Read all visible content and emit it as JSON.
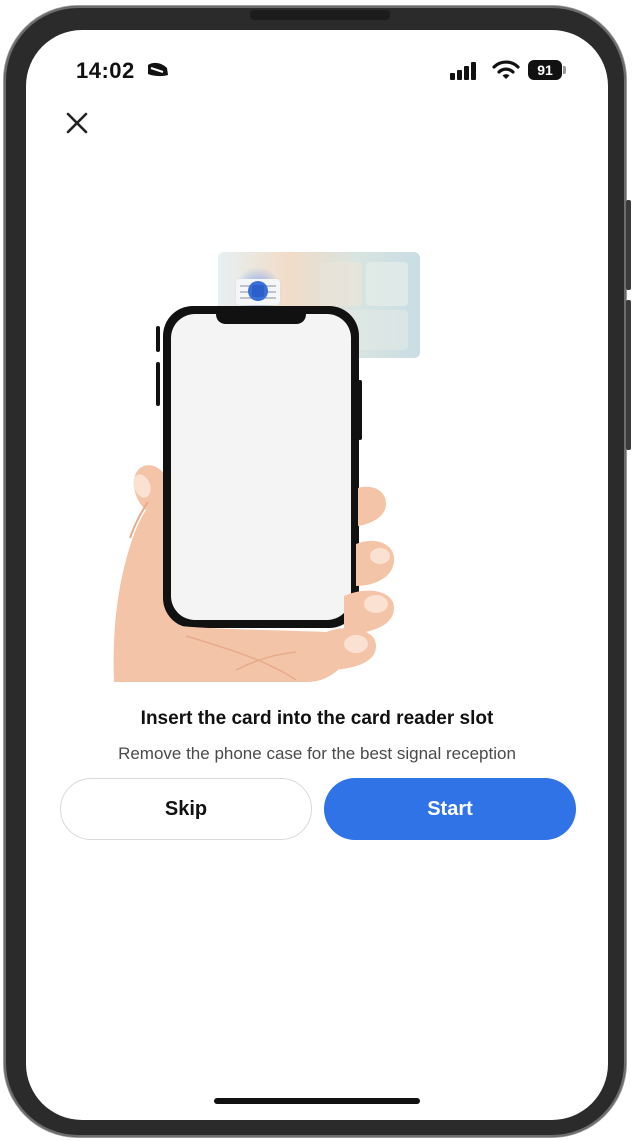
{
  "status_bar": {
    "time": "14:02",
    "battery_level": "91",
    "icons": [
      "focus-mode-icon",
      "cellular-signal-icon",
      "wifi-icon",
      "battery-icon"
    ]
  },
  "header": {
    "close_icon": "close-icon"
  },
  "illustration": {
    "description_icon": "hand-holding-phone-with-card-illustration"
  },
  "content": {
    "title": "Insert the card into the card reader slot",
    "subtitle": "Remove the phone case for the best signal reception"
  },
  "actions": {
    "skip_label": "Skip",
    "start_label": "Start"
  },
  "colors": {
    "accent": "#2f73e6",
    "text_primary": "#111111",
    "text_secondary": "#4a4a4a",
    "skin": "#f3c4a8",
    "card": "#cfe0e6"
  }
}
